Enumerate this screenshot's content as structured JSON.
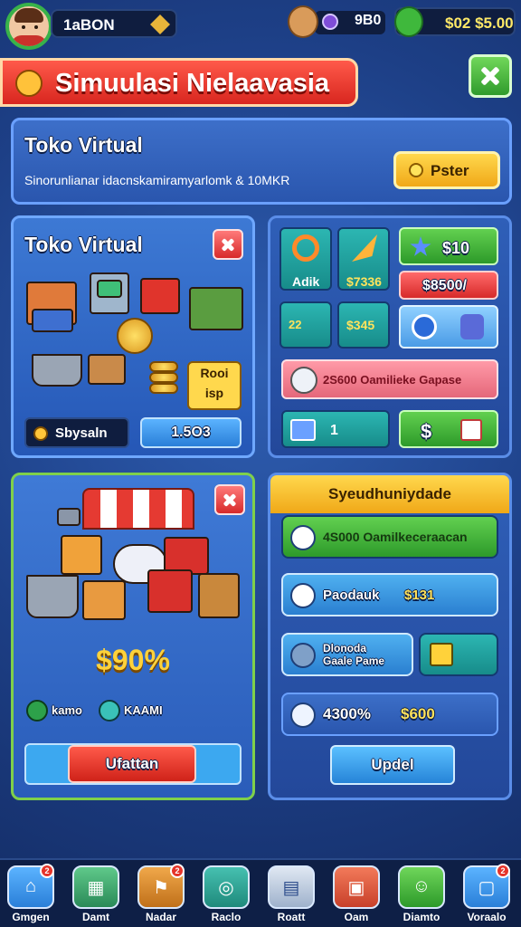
{
  "colors": {
    "accent_red": "#d8261f",
    "accent_green": "#3fb83c",
    "accent_yellow": "#ffd84d",
    "panel_blue": "#2a56ae"
  },
  "topbar": {
    "player_name": "1aBON",
    "mid_value": "9B0",
    "cash": "$02 $5.00",
    "icons": [
      "avatar",
      "rank-icon",
      "character-icon",
      "gem-icon",
      "smile-coin-icon"
    ]
  },
  "title": {
    "text": "Simuulasi Nielaavasia"
  },
  "info": {
    "heading": "Toko Virtual",
    "subtitle": "Sinorunlianar idacnskamiramyarlomk & 10MKR",
    "button_label": "Pster"
  },
  "shop": {
    "heading": "Toko Virtual",
    "note_line1": "Rooi",
    "note_line2": "isp",
    "balance_label": "Sbysaln",
    "value_label": "1.5O3"
  },
  "stats": {
    "tile1_label": "Adik",
    "tile2_label": "$7336",
    "tile3_label": "$10",
    "red_label": "$8500/",
    "tile4_label": "22",
    "tile5_label": "$345",
    "pink_label": "2S600 Oamilieke Gapase",
    "count_label": "1",
    "dollar_label": "$"
  },
  "market": {
    "percent": "$90%",
    "row_label_a": "kamo",
    "row_label_b": "KAAMI",
    "upgrade_label": "Ufattan"
  },
  "community": {
    "heading": "Syeudhuniydade",
    "bar1": "4S000 Oamilkeceraacan",
    "bar2_a": "Paodauk",
    "bar2_b": "$131",
    "bar3_line1": "Dlonoda",
    "bar3_line2": "Gaale Pame",
    "bar4_a": "4300%",
    "bar4_b": "$600",
    "update_label": "Updel"
  },
  "nav": [
    {
      "label": "Gmgen",
      "icon": "home-icon",
      "badge": "2"
    },
    {
      "label": "Damt",
      "icon": "map-icon",
      "badge": ""
    },
    {
      "label": "Nadar",
      "icon": "flag-icon",
      "badge": "2"
    },
    {
      "label": "Raclo",
      "icon": "globe-icon",
      "badge": ""
    },
    {
      "label": "Roatt",
      "icon": "document-icon",
      "badge": ""
    },
    {
      "label": "Oam",
      "icon": "box-icon",
      "badge": ""
    },
    {
      "label": "Diamto",
      "icon": "smile-icon",
      "badge": ""
    },
    {
      "label": "Voraalo",
      "icon": "card-icon",
      "badge": "2"
    }
  ]
}
